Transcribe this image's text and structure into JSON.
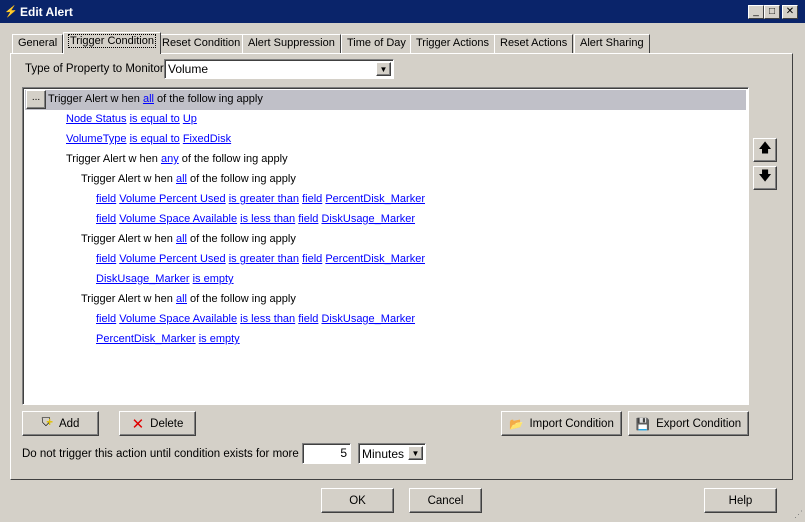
{
  "window": {
    "title": "Edit Alert",
    "min": "_",
    "max": "□",
    "close": "✕"
  },
  "tabs": [
    "General",
    "Trigger Condition",
    "Reset Condition",
    "Alert Suppression",
    "Time of Day",
    "Trigger Actions",
    "Reset Actions",
    "Alert Sharing"
  ],
  "property": {
    "label": "Type of Property to Monitor:",
    "value": "Volume"
  },
  "tree": {
    "menu_button": "...",
    "rows": [
      {
        "level": 0,
        "parts": [
          {
            "t": "Trigger Alert w hen "
          },
          {
            "t": "all",
            "link": true
          },
          {
            "t": " of the follow ing apply"
          }
        ]
      },
      {
        "level": 1,
        "parts": [
          {
            "t": "Node Status",
            "link": true
          },
          {
            "t": " "
          },
          {
            "t": "is equal to",
            "link": true
          },
          {
            "t": " "
          },
          {
            "t": "Up",
            "link": true
          }
        ]
      },
      {
        "level": 1,
        "parts": [
          {
            "t": "VolumeType",
            "link": true
          },
          {
            "t": " "
          },
          {
            "t": "is equal to",
            "link": true
          },
          {
            "t": " "
          },
          {
            "t": "FixedDisk",
            "link": true
          }
        ]
      },
      {
        "level": 1,
        "parts": [
          {
            "t": "Trigger Alert w hen "
          },
          {
            "t": "any",
            "link": true
          },
          {
            "t": " of the follow ing apply"
          }
        ]
      },
      {
        "level": 2,
        "parts": [
          {
            "t": "Trigger Alert w hen "
          },
          {
            "t": "all",
            "link": true
          },
          {
            "t": " of the follow ing apply"
          }
        ]
      },
      {
        "level": 3,
        "parts": [
          {
            "t": "field",
            "link": true
          },
          {
            "t": " "
          },
          {
            "t": "Volume Percent Used",
            "link": true
          },
          {
            "t": " "
          },
          {
            "t": "is greater than",
            "link": true
          },
          {
            "t": " "
          },
          {
            "t": "field",
            "link": true
          },
          {
            "t": " "
          },
          {
            "t": "PercentDisk_Marker",
            "link": true
          }
        ]
      },
      {
        "level": 3,
        "parts": [
          {
            "t": "field",
            "link": true
          },
          {
            "t": " "
          },
          {
            "t": "Volume Space Available",
            "link": true
          },
          {
            "t": " "
          },
          {
            "t": "is less than",
            "link": true
          },
          {
            "t": " "
          },
          {
            "t": "field",
            "link": true
          },
          {
            "t": " "
          },
          {
            "t": "DiskUsage_Marker",
            "link": true
          }
        ]
      },
      {
        "level": 2,
        "parts": [
          {
            "t": "Trigger Alert w hen "
          },
          {
            "t": "all",
            "link": true
          },
          {
            "t": " of the follow ing apply"
          }
        ]
      },
      {
        "level": 3,
        "parts": [
          {
            "t": "field",
            "link": true
          },
          {
            "t": " "
          },
          {
            "t": "Volume Percent Used",
            "link": true
          },
          {
            "t": " "
          },
          {
            "t": "is greater than",
            "link": true
          },
          {
            "t": " "
          },
          {
            "t": "field",
            "link": true
          },
          {
            "t": " "
          },
          {
            "t": "PercentDisk_Marker",
            "link": true
          }
        ]
      },
      {
        "level": 3,
        "parts": [
          {
            "t": "DiskUsage_Marker",
            "link": true
          },
          {
            "t": " "
          },
          {
            "t": "is empty",
            "link": true
          }
        ]
      },
      {
        "level": 2,
        "parts": [
          {
            "t": "Trigger Alert w hen "
          },
          {
            "t": "all",
            "link": true
          },
          {
            "t": " of the follow ing apply"
          }
        ]
      },
      {
        "level": 3,
        "parts": [
          {
            "t": "field",
            "link": true
          },
          {
            "t": " "
          },
          {
            "t": "Volume Space Available",
            "link": true
          },
          {
            "t": " "
          },
          {
            "t": "is less than",
            "link": true
          },
          {
            "t": " "
          },
          {
            "t": "field",
            "link": true
          },
          {
            "t": " "
          },
          {
            "t": "DiskUsage_Marker",
            "link": true
          }
        ]
      },
      {
        "level": 3,
        "parts": [
          {
            "t": "PercentDisk_Marker",
            "link": true
          },
          {
            "t": " "
          },
          {
            "t": "is empty",
            "link": true
          }
        ]
      }
    ]
  },
  "buttons": {
    "add": "Add",
    "delete": "Delete",
    "import": "Import Condition",
    "export": "Export Condition",
    "up": "🡅",
    "down": "🡇",
    "ok": "OK",
    "cancel": "Cancel",
    "help": "Help"
  },
  "delay": {
    "label": "Do not trigger this action until condition exists for more than",
    "value": "5",
    "unit": "Minutes"
  }
}
